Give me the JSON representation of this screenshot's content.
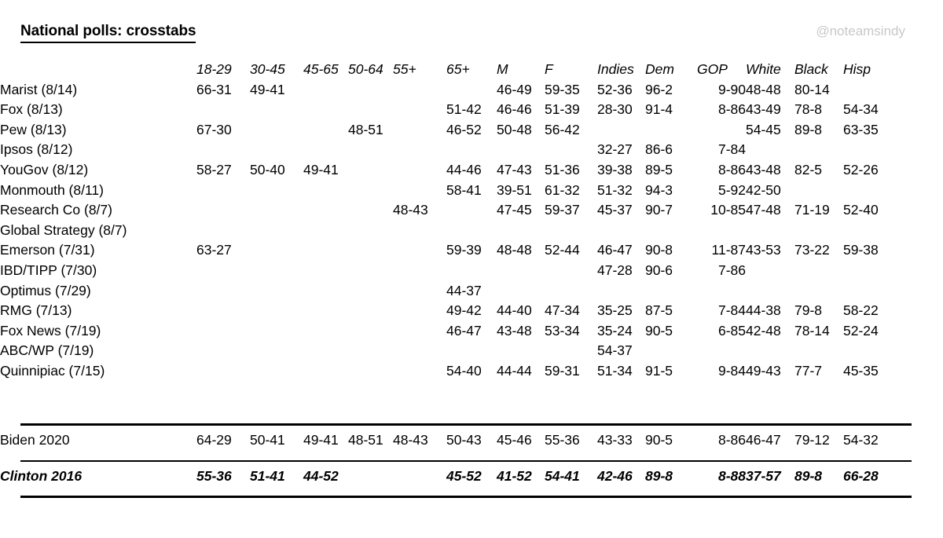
{
  "title": "National polls: crosstabs",
  "watermark": "@noteamsindy",
  "colors": {
    "text": "#000000",
    "watermark": "#c8c8c8",
    "background": "#ffffff"
  },
  "columns": [
    {
      "key": "label",
      "label": ""
    },
    {
      "key": "a1829",
      "label": "18-29"
    },
    {
      "key": "a3045",
      "label": "30-45"
    },
    {
      "key": "a4565",
      "label": "45-65"
    },
    {
      "key": "a5064",
      "label": "50-64"
    },
    {
      "key": "a55p",
      "label": "55+"
    },
    {
      "key": "a65p",
      "label": "65+"
    },
    {
      "key": "m",
      "label": "M"
    },
    {
      "key": "f",
      "label": "F"
    },
    {
      "key": "ind",
      "label": "Indies"
    },
    {
      "key": "dem",
      "label": "Dem"
    },
    {
      "key": "gop",
      "label": "GOP"
    },
    {
      "key": "white",
      "label": "White"
    },
    {
      "key": "black",
      "label": "Black"
    },
    {
      "key": "hisp",
      "label": "Hisp"
    }
  ],
  "rows": [
    {
      "label": "Marist (8/14)",
      "a1829": "66-31",
      "a3045": "49-41",
      "a4565": "",
      "a5064": "",
      "a55p": "",
      "a65p": "",
      "m": "46-49",
      "f": "59-35",
      "ind": "52-36",
      "dem": "96-2",
      "gop": "9-90",
      "white": "48-48",
      "black": "80-14",
      "hisp": ""
    },
    {
      "label": "Fox (8/13)",
      "a1829": "",
      "a3045": "",
      "a4565": "",
      "a5064": "",
      "a55p": "",
      "a65p": "51-42",
      "m": "46-46",
      "f": "51-39",
      "ind": "28-30",
      "dem": "91-4",
      "gop": "8-86",
      "white": "43-49",
      "black": "78-8",
      "hisp": "54-34"
    },
    {
      "label": "Pew (8/13)",
      "a1829": "67-30",
      "a3045": "",
      "a4565": "",
      "a5064": "48-51",
      "a55p": "",
      "a65p": "46-52",
      "m": "50-48",
      "f": "56-42",
      "ind": "",
      "dem": "",
      "gop": "",
      "white": "54-45",
      "black": "89-8",
      "hisp": "63-35"
    },
    {
      "label": "Ipsos (8/12)",
      "a1829": "",
      "a3045": "",
      "a4565": "",
      "a5064": "",
      "a55p": "",
      "a65p": "",
      "m": "",
      "f": "",
      "ind": "32-27",
      "dem": "86-6",
      "gop": "7-84",
      "white": "",
      "black": "",
      "hisp": ""
    },
    {
      "label": "YouGov (8/12)",
      "a1829": "58-27",
      "a3045": "50-40",
      "a4565": "49-41",
      "a5064": "",
      "a55p": "",
      "a65p": "44-46",
      "m": "47-43",
      "f": "51-36",
      "ind": "39-38",
      "dem": "89-5",
      "gop": "8-86",
      "white": "43-48",
      "black": "82-5",
      "hisp": "52-26"
    },
    {
      "label": "Monmouth (8/11)",
      "a1829": "",
      "a3045": "",
      "a4565": "",
      "a5064": "",
      "a55p": "",
      "a65p": "58-41",
      "m": "39-51",
      "f": "61-32",
      "ind": "51-32",
      "dem": "94-3",
      "gop": "5-92",
      "white": "42-50",
      "black": "",
      "hisp": ""
    },
    {
      "label": "Research Co (8/7)",
      "a1829": "",
      "a3045": "",
      "a4565": "",
      "a5064": "",
      "a55p": "48-43",
      "a65p": "",
      "m": "47-45",
      "f": "59-37",
      "ind": "45-37",
      "dem": "90-7",
      "gop": "10-85",
      "white": "47-48",
      "black": "71-19",
      "hisp": "52-40"
    },
    {
      "label": "Global Strategy (8/7)",
      "a1829": "",
      "a3045": "",
      "a4565": "",
      "a5064": "",
      "a55p": "",
      "a65p": "",
      "m": "",
      "f": "",
      "ind": "",
      "dem": "",
      "gop": "",
      "white": "",
      "black": "",
      "hisp": ""
    },
    {
      "label": "Emerson (7/31)",
      "a1829": "63-27",
      "a3045": "",
      "a4565": "",
      "a5064": "",
      "a55p": "",
      "a65p": "59-39",
      "m": "48-48",
      "f": "52-44",
      "ind": "46-47",
      "dem": "90-8",
      "gop": "11-87",
      "white": "43-53",
      "black": "73-22",
      "hisp": "59-38"
    },
    {
      "label": "IBD/TIPP (7/30)",
      "a1829": "",
      "a3045": "",
      "a4565": "",
      "a5064": "",
      "a55p": "",
      "a65p": "",
      "m": "",
      "f": "",
      "ind": "47-28",
      "dem": "90-6",
      "gop": "7-86",
      "white": "",
      "black": "",
      "hisp": ""
    },
    {
      "label": "Optimus (7/29)",
      "a1829": "",
      "a3045": "",
      "a4565": "",
      "a5064": "",
      "a55p": "",
      "a65p": "44-37",
      "m": "",
      "f": "",
      "ind": "",
      "dem": "",
      "gop": "",
      "white": "",
      "black": "",
      "hisp": ""
    },
    {
      "label": "RMG (7/13)",
      "a1829": "",
      "a3045": "",
      "a4565": "",
      "a5064": "",
      "a55p": "",
      "a65p": "49-42",
      "m": "44-40",
      "f": "47-34",
      "ind": "35-25",
      "dem": "87-5",
      "gop": "7-84",
      "white": "44-38",
      "black": "79-8",
      "hisp": "58-22"
    },
    {
      "label": "Fox News (7/19)",
      "a1829": "",
      "a3045": "",
      "a4565": "",
      "a5064": "",
      "a55p": "",
      "a65p": "46-47",
      "m": "43-48",
      "f": "53-34",
      "ind": "35-24",
      "dem": "90-5",
      "gop": "6-85",
      "white": "42-48",
      "black": "78-14",
      "hisp": "52-24"
    },
    {
      "label": "ABC/WP (7/19)",
      "a1829": "",
      "a3045": "",
      "a4565": "",
      "a5064": "",
      "a55p": "",
      "a65p": "",
      "m": "",
      "f": "",
      "ind": "54-37",
      "dem": "",
      "gop": "",
      "white": "",
      "black": "",
      "hisp": ""
    },
    {
      "label": "Quinnipiac (7/15)",
      "a1829": "",
      "a3045": "",
      "a4565": "",
      "a5064": "",
      "a55p": "",
      "a65p": "54-40",
      "m": "44-44",
      "f": "59-31",
      "ind": "51-34",
      "dem": "91-5",
      "gop": "9-84",
      "white": "49-43",
      "black": "77-7",
      "hisp": "45-35"
    }
  ],
  "summary_rows": [
    {
      "label": "Biden 2020",
      "a1829": "64-29",
      "a3045": "50-41",
      "a4565": "49-41",
      "a5064": "48-51",
      "a55p": "48-43",
      "a65p": "50-43",
      "m": "45-46",
      "f": "55-36",
      "ind": "43-33",
      "dem": "90-5",
      "gop": "8-86",
      "white": "46-47",
      "black": "79-12",
      "hisp": "54-32"
    },
    {
      "label": "Clinton 2016",
      "a1829": "55-36",
      "a3045": "51-41",
      "a4565": "44-52",
      "a5064": "",
      "a55p": "",
      "a65p": "45-52",
      "m": "41-52",
      "f": "54-41",
      "ind": "42-46",
      "dem": "89-8",
      "gop": "8-88",
      "white": "37-57",
      "black": "89-8",
      "hisp": "66-28"
    }
  ]
}
